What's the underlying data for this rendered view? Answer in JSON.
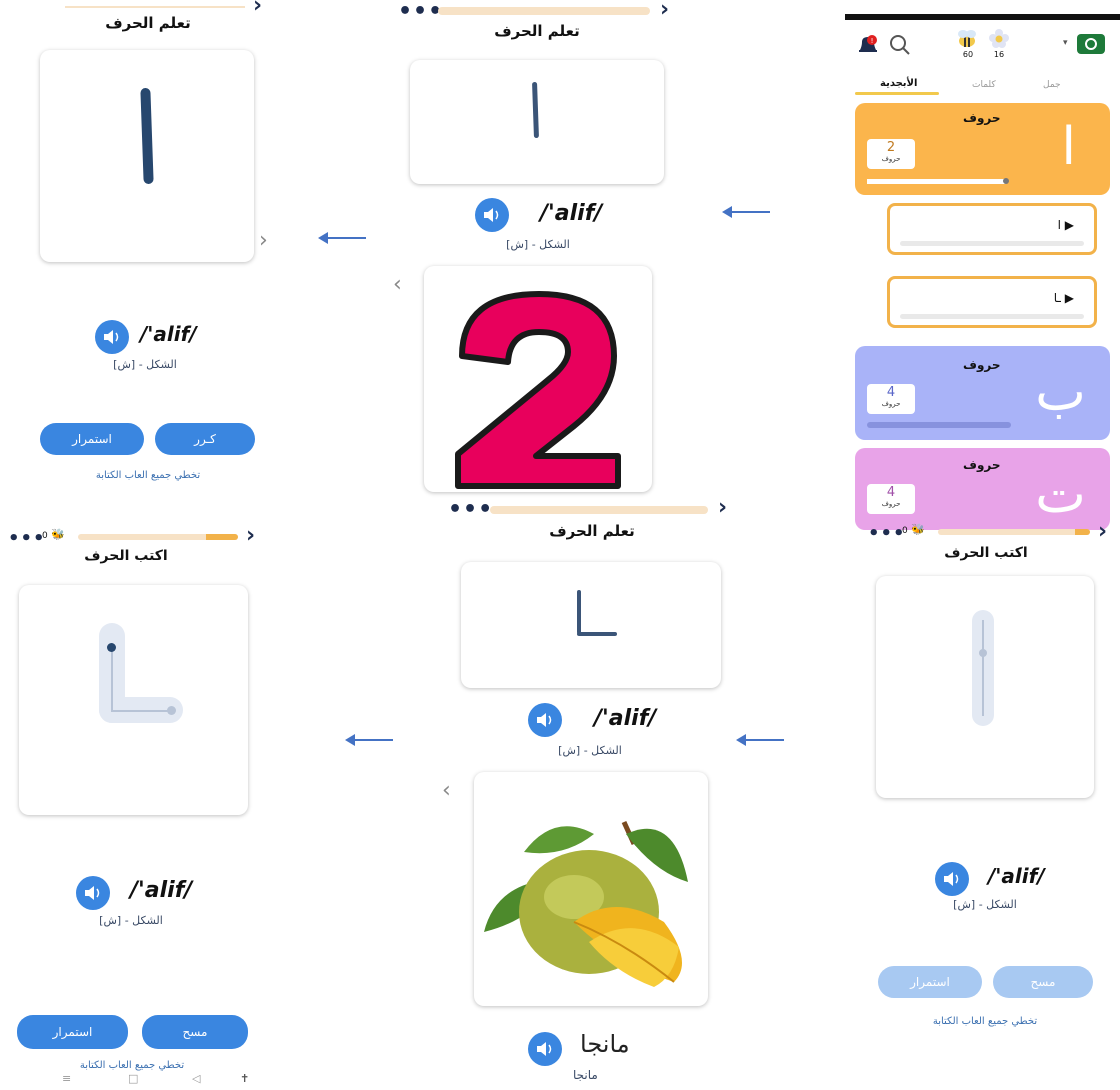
{
  "app": {
    "title_learn": "تعلم الحرف",
    "title_write": "اكتب الحرف",
    "pronunciation": "/'alif/",
    "form_label": "[ش] - الشكل",
    "skip_text": "تخطي جميع العاب الكتابة",
    "repeat_button": "كـرر",
    "continue_button": "استمرار",
    "erase_button": "مسح",
    "word_mango": "مانجا",
    "word_mango_sub": "مانجا",
    "dots": "•••",
    "chevron": "›",
    "back_chevron": "‹",
    "next_chevron": "›",
    "bee_count": "0",
    "progress_top": 0.0,
    "progress_write_left": 0.2,
    "progress_write_right": 0.1
  },
  "home": {
    "tabs": [
      "جمل",
      "كلمات",
      "الأبجدية"
    ],
    "active_tab": "الأبجدية",
    "bee_count": "60",
    "flower_count": "16",
    "lessons": [
      {
        "label": "حروف",
        "count": "2",
        "count_label": "حروف",
        "glyph": "ا",
        "color": "#fbb54c",
        "progress": 0.9
      },
      {
        "label": "حروف",
        "count": "4",
        "count_label": "حروف",
        "glyph": "ب",
        "color": "#a9b3f8",
        "progress": 0.0
      },
      {
        "label": "حروف",
        "count": "4",
        "count_label": "حروف",
        "glyph": "ت",
        "color": "#e8a3e8",
        "progress": 0.0
      }
    ],
    "sub_items": [
      "ا",
      "ـا"
    ]
  },
  "nav": {
    "menu_icon": "≡",
    "home_icon": "□",
    "back_icon": "◁",
    "accessibility_icon": "✝"
  },
  "colors": {
    "accent_blue": "#3a86e0",
    "pale_blue": "#a8c9f2",
    "orange": "#fbb54c",
    "lavender": "#a9b3f8",
    "pink": "#e8a3e8",
    "digit_pink": "#e8005c",
    "arrow": "#4472c4"
  }
}
